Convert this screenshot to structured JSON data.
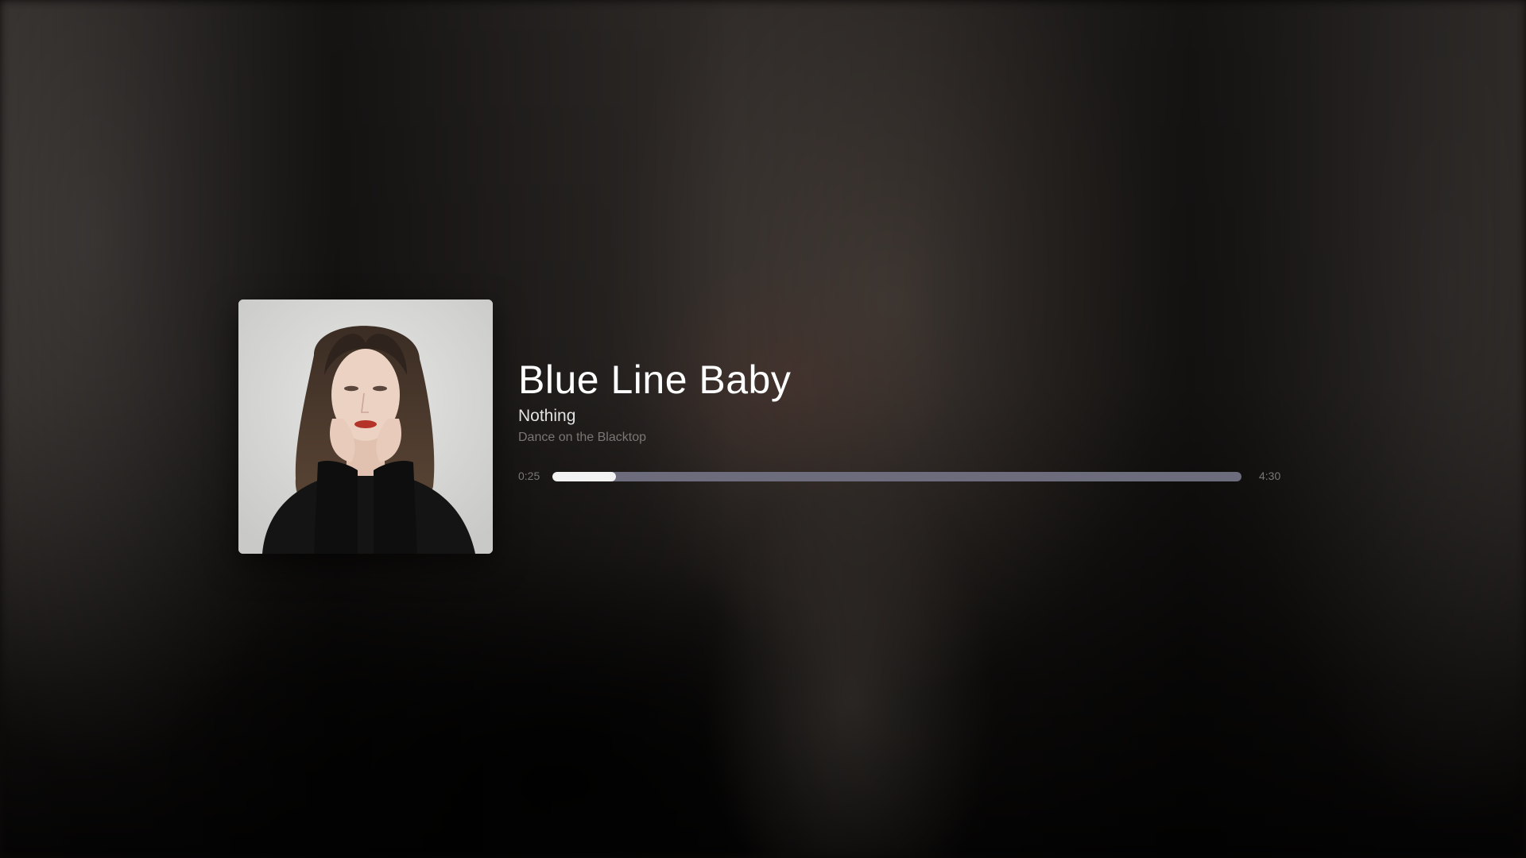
{
  "now_playing": {
    "title": "Blue Line Baby",
    "artist": "Nothing",
    "album": "Dance on the Blacktop",
    "artwork_icon": "album-artwork"
  },
  "progress": {
    "elapsed": "0:25",
    "total": "4:30",
    "fraction": 0.0926
  },
  "colors": {
    "track": "#6c6c7d",
    "fill": "#f2f2f2",
    "title": "#ffffff",
    "secondary": "#7a7674"
  }
}
